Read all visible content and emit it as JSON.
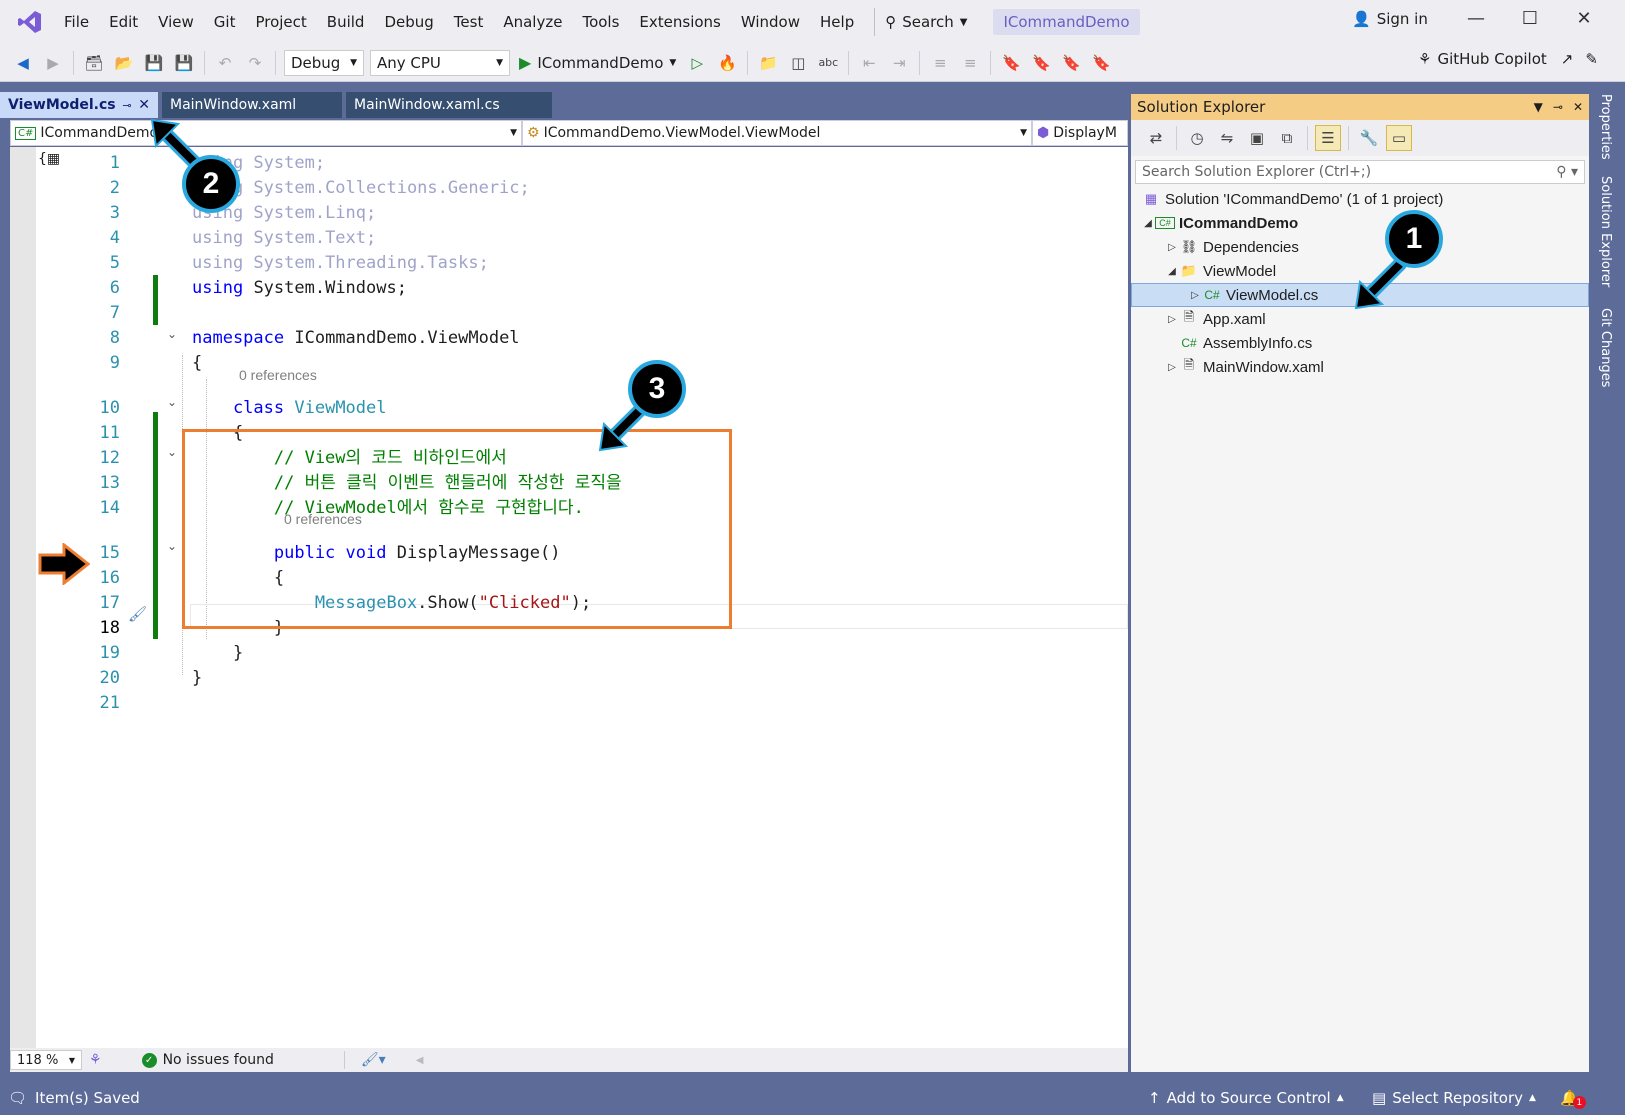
{
  "menubar": {
    "items": [
      "File",
      "Edit",
      "View",
      "Git",
      "Project",
      "Build",
      "Debug",
      "Test",
      "Analyze",
      "Tools",
      "Extensions",
      "Window",
      "Help"
    ],
    "search_label": "Search",
    "solution_name": "ICommandDemo",
    "sign_in": "Sign in"
  },
  "toolbar": {
    "config": "Debug",
    "platform": "Any CPU",
    "run_target": "ICommandDemo",
    "copilot": "GitHub Copilot"
  },
  "tabs": [
    {
      "label": "ViewModel.cs",
      "active": true
    },
    {
      "label": "MainWindow.xaml",
      "active": false
    },
    {
      "label": "MainWindow.xaml.cs",
      "active": false
    }
  ],
  "navbar": {
    "project": "ICommandDemo",
    "type": "ICommandDemo.ViewModel.ViewModel",
    "member": "DisplayM"
  },
  "code": {
    "lines": [
      {
        "n": "1",
        "parts": [
          [
            "dim",
            "using"
          ],
          [
            "dim",
            " System;"
          ]
        ]
      },
      {
        "n": "2",
        "parts": [
          [
            "dim",
            "using"
          ],
          [
            "dim",
            " System.Collections.Generic;"
          ]
        ]
      },
      {
        "n": "3",
        "parts": [
          [
            "dim",
            "using"
          ],
          [
            "dim",
            " System.Linq;"
          ]
        ]
      },
      {
        "n": "4",
        "parts": [
          [
            "dim",
            "using"
          ],
          [
            "dim",
            " System.Text;"
          ]
        ]
      },
      {
        "n": "5",
        "parts": [
          [
            "dim",
            "using"
          ],
          [
            "dim",
            " System.Threading.Tasks;"
          ]
        ]
      },
      {
        "n": "6",
        "parts": [
          [
            "kw",
            "using"
          ],
          [
            "",
            "System.Windows;"
          ]
        ]
      },
      {
        "n": "7",
        "parts": []
      },
      {
        "n": "8",
        "parts": [
          [
            "kw",
            "namespace"
          ],
          [
            "",
            "ICommandDemo.ViewModel"
          ]
        ]
      },
      {
        "n": "9",
        "parts": [
          [
            "",
            "{"
          ]
        ]
      },
      {
        "n": "10",
        "parts": [
          [
            "kw",
            "    class"
          ],
          [
            "typ",
            "ViewModel"
          ]
        ]
      },
      {
        "n": "11",
        "parts": [
          [
            "",
            "    {"
          ]
        ]
      },
      {
        "n": "12",
        "parts": [
          [
            "cmt",
            "        // View의 코드 비하인드에서"
          ]
        ]
      },
      {
        "n": "13",
        "parts": [
          [
            "cmt",
            "        // 버튼 클릭 이벤트 핸들러에 작성한 로직을"
          ]
        ]
      },
      {
        "n": "14",
        "parts": [
          [
            "cmt",
            "        // ViewModel에서 함수로 구현합니다."
          ]
        ]
      },
      {
        "n": "15",
        "parts": [
          [
            "kw",
            "        public void"
          ],
          [
            "",
            "DisplayMessage()"
          ]
        ]
      },
      {
        "n": "16",
        "parts": [
          [
            "",
            "        {"
          ]
        ]
      },
      {
        "n": "17",
        "parts": [
          [
            "typ",
            "            MessageBox"
          ],
          [
            "",
            ".Show("
          ],
          [
            "str",
            "\"Clicked\""
          ],
          [
            "",
            ");"
          ]
        ]
      },
      {
        "n": "18",
        "parts": [
          [
            "",
            "        }"
          ]
        ]
      },
      {
        "n": "19",
        "parts": [
          [
            "",
            "    }"
          ]
        ]
      },
      {
        "n": "20",
        "parts": [
          [
            "",
            "}"
          ]
        ]
      },
      {
        "n": "21",
        "parts": []
      }
    ],
    "references_label": "0 references"
  },
  "editor_status": {
    "zoom": "118 %",
    "issues": "No issues found"
  },
  "solution_explorer": {
    "title": "Solution Explorer",
    "search_placeholder": "Search Solution Explorer (Ctrl+;)",
    "items": [
      {
        "label": "Solution 'ICommandDemo' (1 of 1 project)",
        "icon": "solution-icon"
      },
      {
        "label": "ICommandDemo",
        "icon": "csharp-project-icon"
      },
      {
        "label": "Dependencies",
        "icon": "dependencies-icon"
      },
      {
        "label": "ViewModel",
        "icon": "folder-icon"
      },
      {
        "label": "ViewModel.cs",
        "icon": "csharp-file-icon"
      },
      {
        "label": "App.xaml",
        "icon": "xaml-file-icon"
      },
      {
        "label": "AssemblyInfo.cs",
        "icon": "csharp-file-icon"
      },
      {
        "label": "MainWindow.xaml",
        "icon": "xaml-file-icon"
      }
    ]
  },
  "side_tabs": [
    "Properties",
    "Solution Explorer",
    "Git Changes"
  ],
  "statusbar": {
    "message": "Item(s) Saved",
    "source_control": "Add to Source Control",
    "repository": "Select Repository",
    "notifications": "1"
  },
  "annotations": [
    "1",
    "2",
    "3"
  ],
  "colors": {
    "accent": "#5d6b99",
    "highlight_box": "#ed7d31",
    "badge_border": "#29a8e0",
    "change_bar": "#107c10"
  }
}
